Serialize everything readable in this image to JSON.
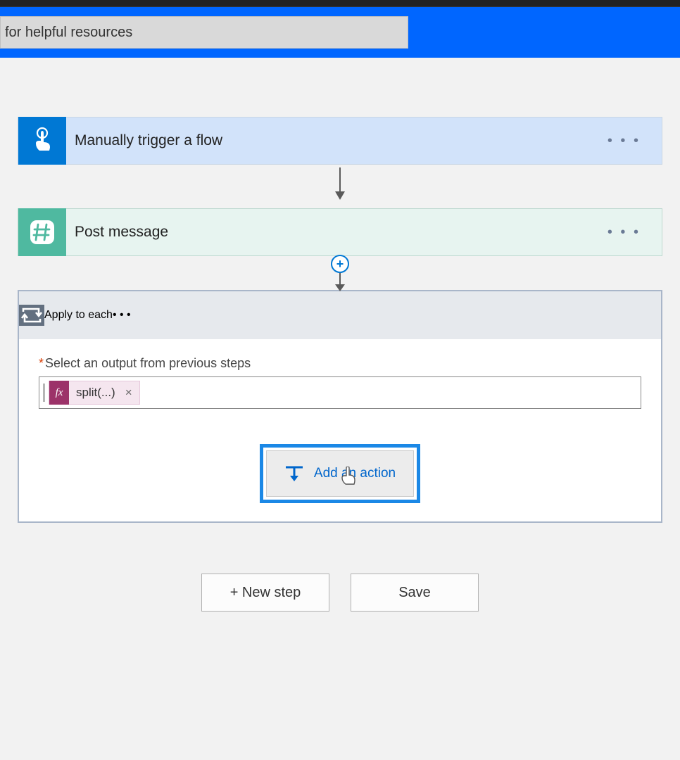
{
  "search": {
    "text": "for helpful resources"
  },
  "steps": {
    "trigger": {
      "title": "Manually trigger a flow"
    },
    "post": {
      "title": "Post message"
    },
    "loop": {
      "title": "Apply to each",
      "field_label": "Select an output from previous steps",
      "token": {
        "fx": "fx",
        "label": "split(...)",
        "close": "×"
      },
      "add_action_label": "Add an action"
    }
  },
  "buttons": {
    "new_step": "+ New step",
    "save": "Save"
  },
  "glyphs": {
    "menu_dots": "• • •",
    "plus": "+"
  }
}
